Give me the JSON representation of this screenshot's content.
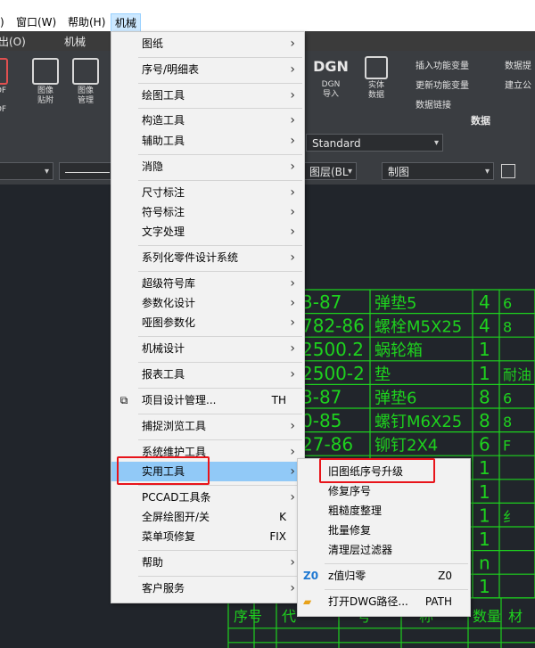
{
  "menubar": {
    "items": [
      {
        "label": ")"
      },
      {
        "label": "窗口(W)"
      },
      {
        "label": "帮助(H)"
      },
      {
        "label": "机械"
      }
    ]
  },
  "tabs": {
    "items": [
      {
        "label": "出(O)"
      },
      {
        "label": "机械"
      }
    ]
  },
  "ribbon": {
    "pdf_label": "DF",
    "pdf_label2": "DF",
    "image_paste": "图像\n贴附",
    "image_manage": "图像\n管理",
    "dgn_logo": "DGN",
    "dgn_import": "DGN\n导入",
    "entity_data": "实体\n数据",
    "insert_feature_var": "插入功能变量",
    "update_feature_var": "更新功能变量",
    "data_link": "数据链接",
    "data_extract": "数据提",
    "create_public": "建立公",
    "group_data": "数据"
  },
  "toolbar": {
    "text_style": "Standard",
    "layer_label": "图层(BL",
    "layer_value": "制图"
  },
  "menu": {
    "items": [
      {
        "label": "图纸",
        "submenu": true
      },
      {
        "label": "序号/明细表",
        "submenu": true
      },
      {
        "label": "绘图工具",
        "submenu": true
      },
      {
        "label": "构造工具",
        "submenu": true
      },
      {
        "label": "辅助工具",
        "submenu": true
      },
      {
        "label": "消隐",
        "submenu": true
      },
      {
        "label": "尺寸标注",
        "submenu": true
      },
      {
        "label": "符号标注",
        "submenu": true
      },
      {
        "label": "文字处理",
        "submenu": true
      },
      {
        "label": "系列化零件设计系统",
        "submenu": true
      },
      {
        "label": "超级符号库",
        "submenu": true
      },
      {
        "label": "参数化设计",
        "submenu": true
      },
      {
        "label": "哑图参数化",
        "submenu": true
      },
      {
        "label": "机械设计",
        "submenu": true
      },
      {
        "label": "报表工具",
        "submenu": true
      },
      {
        "label": "项目设计管理...",
        "shortcut": "TH"
      },
      {
        "label": "捕捉浏览工具",
        "submenu": true
      },
      {
        "label": "系统维护工具",
        "submenu": true
      },
      {
        "label": "实用工具",
        "submenu": true
      },
      {
        "label": "PCCAD工具条",
        "submenu": true
      },
      {
        "label": "全屏绘图开/关",
        "shortcut": "K"
      },
      {
        "label": "菜单项修复",
        "shortcut": "FIX"
      },
      {
        "label": "帮助",
        "submenu": true
      },
      {
        "label": "客户服务",
        "submenu": true
      }
    ],
    "chevron": "›"
  },
  "submenu": {
    "items": [
      {
        "label": "旧图纸序号升级"
      },
      {
        "label": "修复序号"
      },
      {
        "label": "粗糙度整理"
      },
      {
        "label": "批量修复"
      },
      {
        "label": "清理层过滤器"
      },
      {
        "label": "z值归零",
        "shortcut": "Z0",
        "icon": "Z0"
      },
      {
        "label": "打开DWG路径...",
        "shortcut": "PATH"
      }
    ]
  },
  "drawing": {
    "rows": [
      {
        "code": "3-87",
        "name": "弹垫5",
        "qty": "4",
        "extra": "6"
      },
      {
        "code": "782-86",
        "name": "螺栓M5X25",
        "qty": "4",
        "extra": "8"
      },
      {
        "code": "2500.2",
        "name": "蜗轮箱",
        "qty": "1",
        "extra": ""
      },
      {
        "code": "2500-2",
        "name": "垫",
        "qty": "1",
        "extra": "耐油"
      },
      {
        "code": "3-87",
        "name": "弹垫6",
        "qty": "8",
        "extra": "6"
      },
      {
        "code": "0-85",
        "name": "螺钉M6X25",
        "qty": "8",
        "extra": "8"
      },
      {
        "code": "27-86",
        "name": "铆钉2X4",
        "qty": "6",
        "extra": "F"
      },
      {
        "code": "",
        "name": "",
        "qty": "1",
        "extra": ""
      },
      {
        "code": "",
        "name": "",
        "qty": "1",
        "extra": ""
      },
      {
        "code": "",
        "name": "",
        "qty": "1",
        "extra": "纟"
      },
      {
        "code": "",
        "name": "",
        "qty": "1",
        "extra": ""
      },
      {
        "code": "",
        "name": "",
        "qty": "n",
        "extra": ""
      },
      {
        "code": "",
        "name": "",
        "qty": "1",
        "extra": ""
      }
    ],
    "header": [
      "序号",
      "代",
      "号",
      "称",
      "数量",
      "材"
    ]
  }
}
